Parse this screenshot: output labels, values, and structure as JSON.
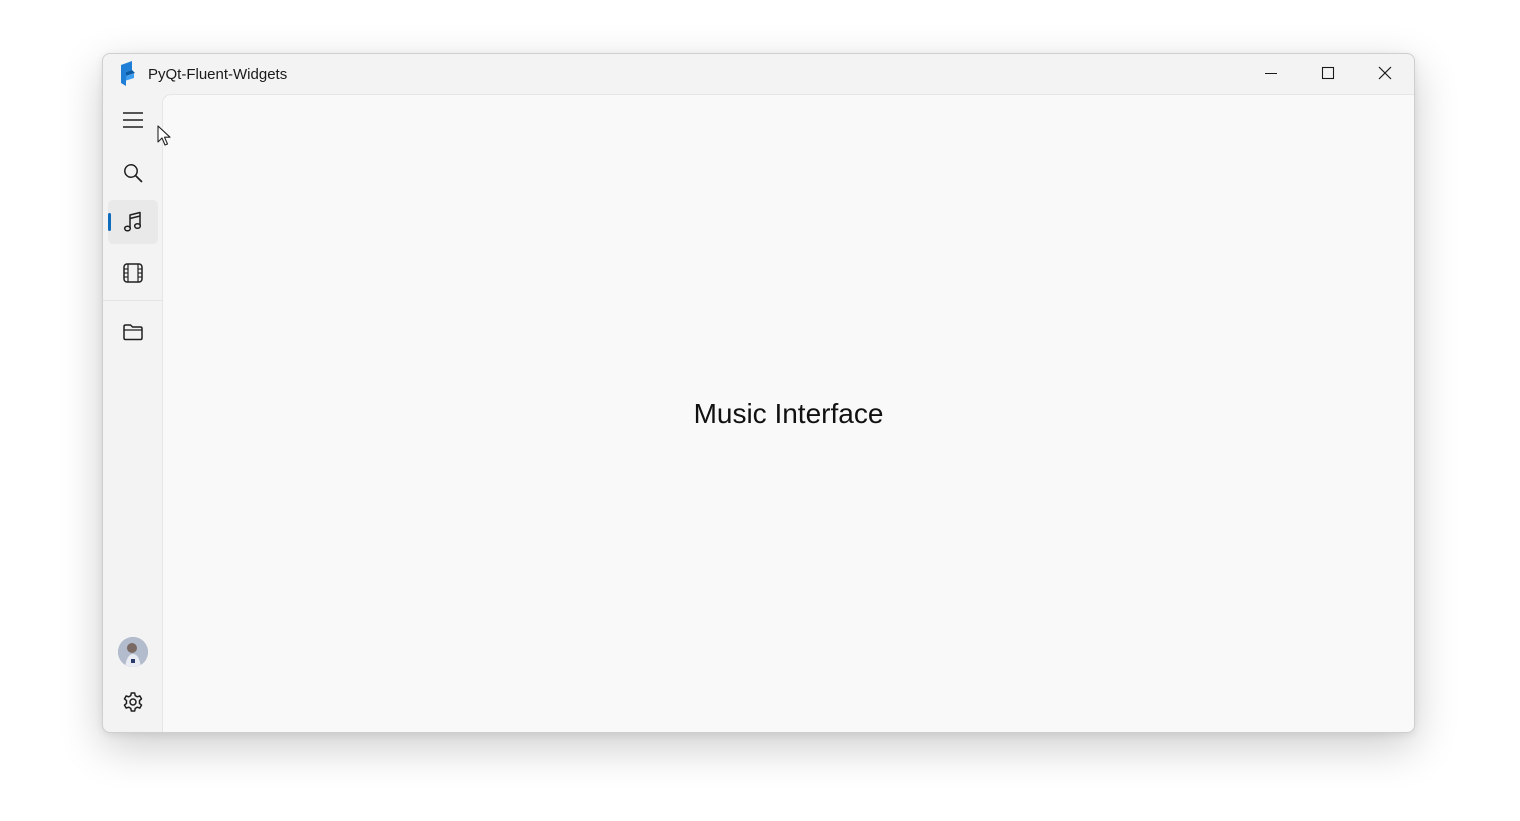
{
  "window": {
    "title": "PyQt-Fluent-Widgets"
  },
  "titlebar": {
    "logo_icon": "pyqt-fluent-logo-icon",
    "buttons": {
      "minimize": "minimize-icon",
      "maximize": "maximize-icon",
      "close": "close-icon"
    }
  },
  "sidebar": {
    "top_items": [
      {
        "id": "menu",
        "icon": "hamburger-menu-icon",
        "selected": false
      },
      {
        "id": "search",
        "icon": "search-icon",
        "selected": false
      },
      {
        "id": "music",
        "icon": "music-note-icon",
        "selected": true
      },
      {
        "id": "video",
        "icon": "film-icon",
        "selected": false
      }
    ],
    "scroll_items": [
      {
        "id": "folder",
        "icon": "folder-icon",
        "selected": false
      }
    ],
    "bottom_items": [
      {
        "id": "avatar",
        "icon": "avatar",
        "selected": false
      },
      {
        "id": "settings",
        "icon": "gear-icon",
        "selected": false
      }
    ]
  },
  "main": {
    "label": "Music Interface"
  },
  "colors": {
    "accent": "#0f6cbd",
    "window_bg": "#f3f3f3",
    "content_bg": "#f9f9f9",
    "selected_item_bg": "#e9e9e9"
  }
}
